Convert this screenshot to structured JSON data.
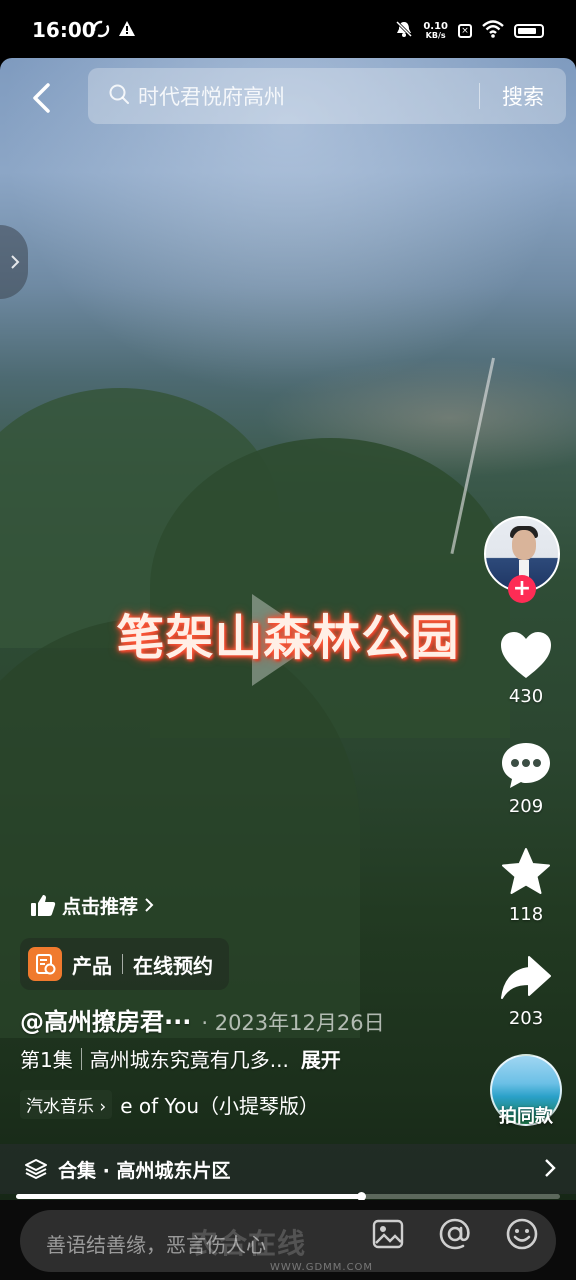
{
  "status_bar": {
    "time": "16:00",
    "net_speed_value": "0.10",
    "net_speed_unit": "KB/s",
    "box_icon_glyph": "×",
    "icons": [
      "sync-icon",
      "warning-icon",
      "mute-icon",
      "wifi-icon",
      "battery-icon"
    ]
  },
  "search": {
    "query": "时代君悦府高州",
    "button_label": "搜索"
  },
  "video": {
    "overlay_title": "笔架山森林公园"
  },
  "rail": {
    "likes": "430",
    "comments": "209",
    "favorites": "118",
    "shares": "203",
    "follow_symbol": "+",
    "same_style_label": "拍同款"
  },
  "info": {
    "recommend_label": "点击推荐",
    "product_label": "产品",
    "product_action": "在线预约",
    "author": "@高州撩房君···",
    "date": "· 2023年12月26日",
    "episode": "第1集",
    "description": "高州城东究竟有几多...",
    "expand_label": "展开",
    "music_tag": "汽水音乐",
    "music_title": "e of You（小提琴版）",
    "collection_label": "合集 · 高州城东片区"
  },
  "progress": {
    "fraction": 0.635
  },
  "bottom": {
    "comment_placeholder": "善语结善缘，恶言伤人心",
    "watermark": "农合在线",
    "watermark_url": "WWW.GDMM.COM"
  },
  "colors": {
    "accent_red": "#fe2c55",
    "product_orange": "#f07a2e",
    "title_glow": "#ff5a3a"
  }
}
